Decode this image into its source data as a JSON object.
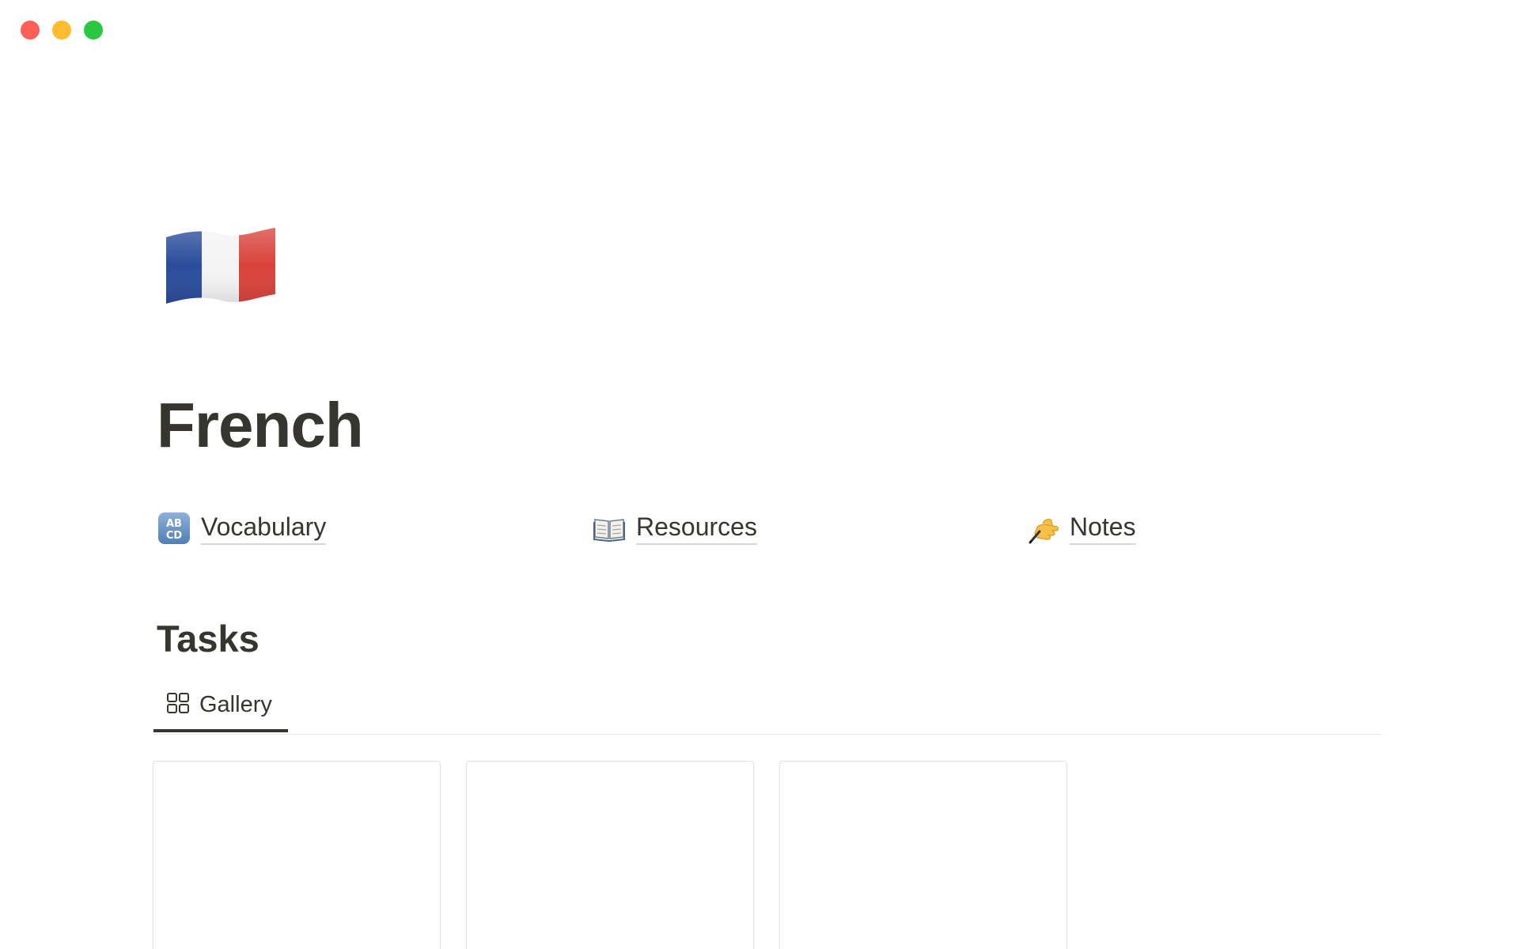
{
  "window": {
    "controls": {
      "close_color": "#fe5f57",
      "minimize_color": "#febc2e",
      "zoom_color": "#28c840"
    }
  },
  "page": {
    "icon": "france-flag-icon",
    "title": "French"
  },
  "links": [
    {
      "icon": "abcd-icon",
      "label": "Vocabulary"
    },
    {
      "icon": "open-book-icon",
      "label": "Resources"
    },
    {
      "icon": "writing-hand-icon",
      "label": "Notes"
    }
  ],
  "tasks": {
    "title": "Tasks",
    "views": [
      {
        "icon": "gallery-grid-icon",
        "label": "Gallery",
        "active": true
      }
    ],
    "cards": [
      {},
      {},
      {}
    ]
  },
  "colors": {
    "text": "#37352f",
    "divider": "#e6e6e4",
    "flag_blue": "#2a4c9b",
    "flag_white": "#f4f4f4",
    "flag_red": "#d9423b"
  }
}
